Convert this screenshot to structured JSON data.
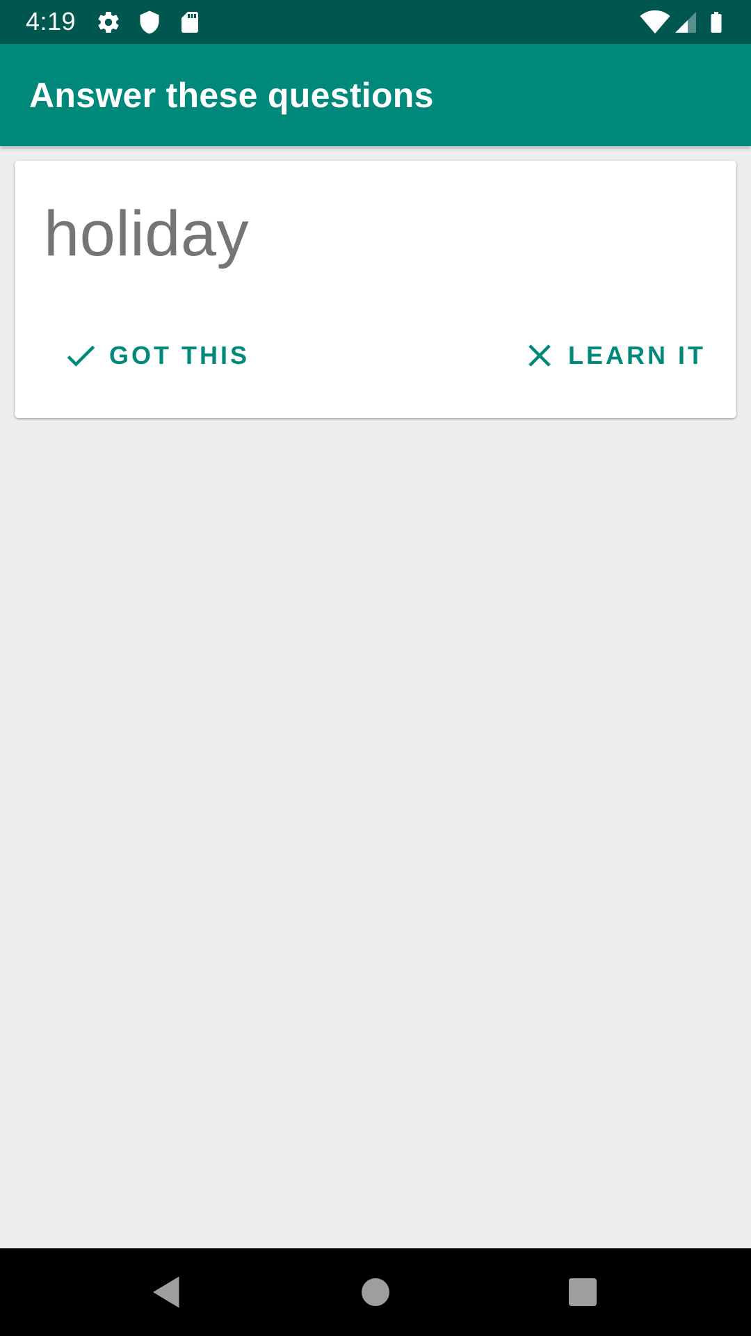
{
  "status_bar": {
    "time": "4:19",
    "icons": [
      "gear-icon",
      "shield-icon",
      "sd-card-icon",
      "wifi-icon",
      "signal-icon",
      "battery-icon"
    ]
  },
  "app_bar": {
    "title": "Answer these questions"
  },
  "card": {
    "word": "holiday",
    "got_label": "GOT THIS",
    "learn_label": "LEARN IT"
  },
  "nav_bar": {
    "icons": [
      "back-icon",
      "home-icon",
      "recents-icon"
    ]
  },
  "colors": {
    "status_bar": "#00574f",
    "primary": "#00897b",
    "background": "#eeeeee",
    "word_text": "#757575"
  }
}
